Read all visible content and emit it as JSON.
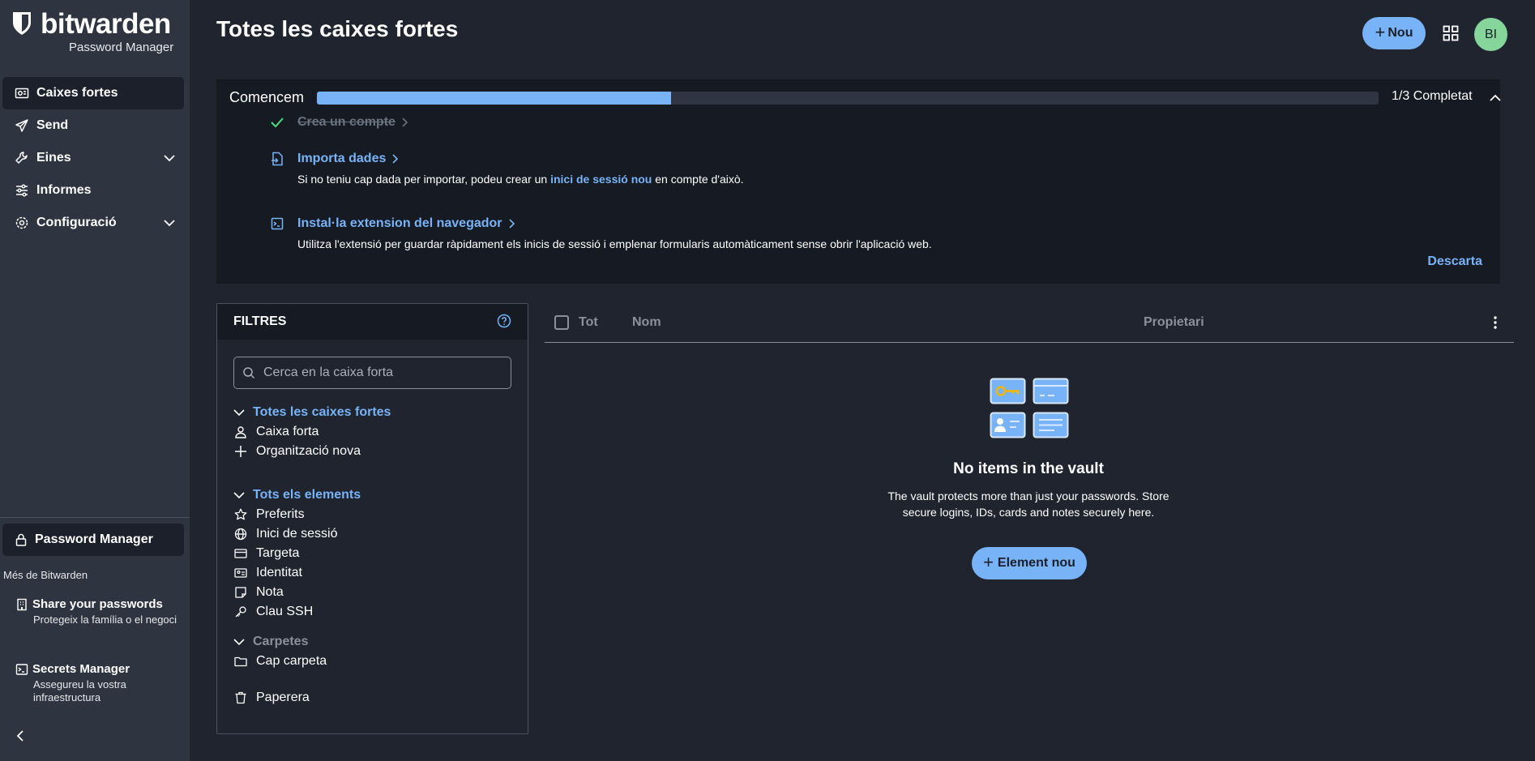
{
  "brand": {
    "name": "bitwarden",
    "product": "Password Manager"
  },
  "sidebar": {
    "items": [
      {
        "label": "Caixes fortes",
        "icon": "vault-icon"
      },
      {
        "label": "Send",
        "icon": "send-icon"
      },
      {
        "label": "Eines",
        "icon": "tools-icon"
      },
      {
        "label": "Informes",
        "icon": "reports-icon"
      },
      {
        "label": "Configuració",
        "icon": "gear-icon"
      }
    ],
    "product_switcher": "Password Manager",
    "more_label": "Més de Bitwarden",
    "promos": [
      {
        "title": "Share your passwords",
        "desc": "Protegeix la família o el negoci",
        "icon": "building-icon"
      },
      {
        "title": "Secrets Manager",
        "desc": "Assegureu la vostra infraestructura",
        "icon": "terminal-icon"
      }
    ]
  },
  "header": {
    "title": "Totes les caixes fortes",
    "new_label": "Nou",
    "avatar_initials": "BI"
  },
  "getting_started": {
    "title": "Comencem",
    "progress": 0.3333,
    "count": "1/3 Completat",
    "dismiss": "Descarta",
    "tasks": [
      {
        "title": "Crea un compte",
        "done": true
      },
      {
        "title": "Importa dades",
        "desc_before": "Si no teniu cap dada per importar, podeu crear un ",
        "desc_link": "inici de sessió nou",
        "desc_after": " en compte d'això."
      },
      {
        "title": "Instal·la extension del navegador",
        "desc": "Utilitza l'extensió per guardar ràpidament els inicis de sessió i emplenar formularis automàticament sense obrir l'aplicació web."
      }
    ]
  },
  "filters": {
    "title": "FILTRES",
    "search_placeholder": "Cerca en la caixa forta",
    "vaults_header": "Totes les caixes fortes",
    "vaults": [
      "Caixa forta",
      "Organització nova"
    ],
    "types_header": "Tots els elements",
    "types": [
      "Preferits",
      "Inici de sessió",
      "Targeta",
      "Identitat",
      "Nota",
      "Clau SSH"
    ],
    "folders_header": "Carpetes",
    "folders": [
      "Cap carpeta"
    ],
    "trash": "Paperera"
  },
  "list": {
    "col_all": "Tot",
    "col_name": "Nom",
    "col_owner": "Propietari",
    "empty_title": "No items in the vault",
    "empty_desc": "The vault protects more than just your passwords. Store secure logins, IDs, cards and notes securely here.",
    "new_item_label": "Element nou"
  },
  "colors": {
    "accent": "#79b3f7",
    "sidebar": "#2e3440",
    "background": "#1f242e",
    "panel": "#151a23",
    "avatar": "#86d69c"
  }
}
